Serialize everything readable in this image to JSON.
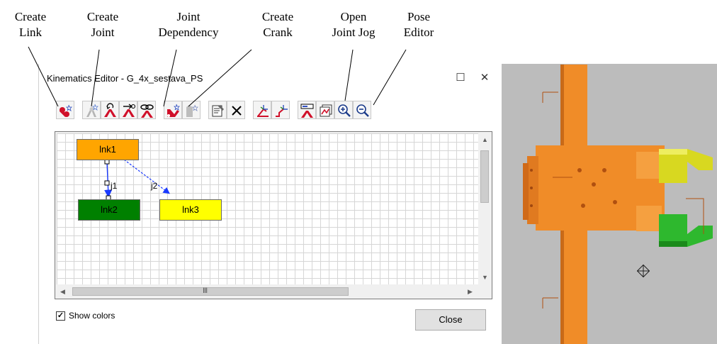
{
  "callouts": {
    "create_link": [
      "Create",
      "Link"
    ],
    "create_joint": [
      "Create",
      "Joint"
    ],
    "joint_dependency": [
      "Joint",
      "Dependency"
    ],
    "create_crank": [
      "Create",
      "Crank"
    ],
    "open_joint_jog": [
      "Open",
      "Joint Jog"
    ],
    "pose_editor": [
      "Pose",
      "Editor"
    ]
  },
  "dialog": {
    "title": "Kinematics Editor -  G_4x_sestava_PS",
    "maximize_glyph": "☐",
    "close_glyph": "✕",
    "show_colors_label": "Show colors",
    "show_colors_checked": true,
    "check_glyph": "✓",
    "close_button": "Close"
  },
  "graph": {
    "nodes": [
      {
        "id": "lnk1",
        "label": "lnk1",
        "color": "#ffa500"
      },
      {
        "id": "lnk2",
        "label": "lnk2",
        "color": "#008000"
      },
      {
        "id": "lnk3",
        "label": "lnk3",
        "color": "#ffff00"
      }
    ],
    "edges": [
      {
        "label": "j1",
        "from": "lnk1",
        "to": "lnk2"
      },
      {
        "label": "j2",
        "from": "lnk1",
        "to": "lnk3"
      }
    ],
    "scrollbar_grip": "III"
  },
  "toolbar": {
    "buttons": [
      {
        "name": "create-link",
        "icon": "link-icon"
      },
      {
        "name": "create-joint",
        "icon": "joint-icon"
      },
      {
        "name": "joint-revolute",
        "icon": "revolute-joint-icon"
      },
      {
        "name": "joint-prismatic",
        "icon": "prismatic-joint-icon"
      },
      {
        "name": "joint-dependency",
        "icon": "joint-dependency-icon"
      },
      {
        "name": "create-crank",
        "icon": "crank-icon"
      },
      {
        "name": "create-cam",
        "icon": "cam-icon"
      },
      {
        "name": "properties",
        "icon": "properties-icon"
      },
      {
        "name": "delete",
        "icon": "delete-icon"
      },
      {
        "name": "set-base",
        "icon": "base-icon"
      },
      {
        "name": "set-tool",
        "icon": "tool-icon"
      },
      {
        "name": "open-joint-jog",
        "icon": "joint-jog-icon"
      },
      {
        "name": "pose-editor",
        "icon": "pose-editor-icon"
      },
      {
        "name": "zoom-in",
        "icon": "zoom-in-icon"
      },
      {
        "name": "zoom-out",
        "icon": "zoom-out-icon"
      }
    ]
  },
  "colors": {
    "link_red": "#d0102a",
    "model_orange": "#f08c28",
    "gripper_yellow": "#d8d820",
    "gripper_green": "#2eb82e",
    "viewport_bg": "#bcbcbc"
  }
}
